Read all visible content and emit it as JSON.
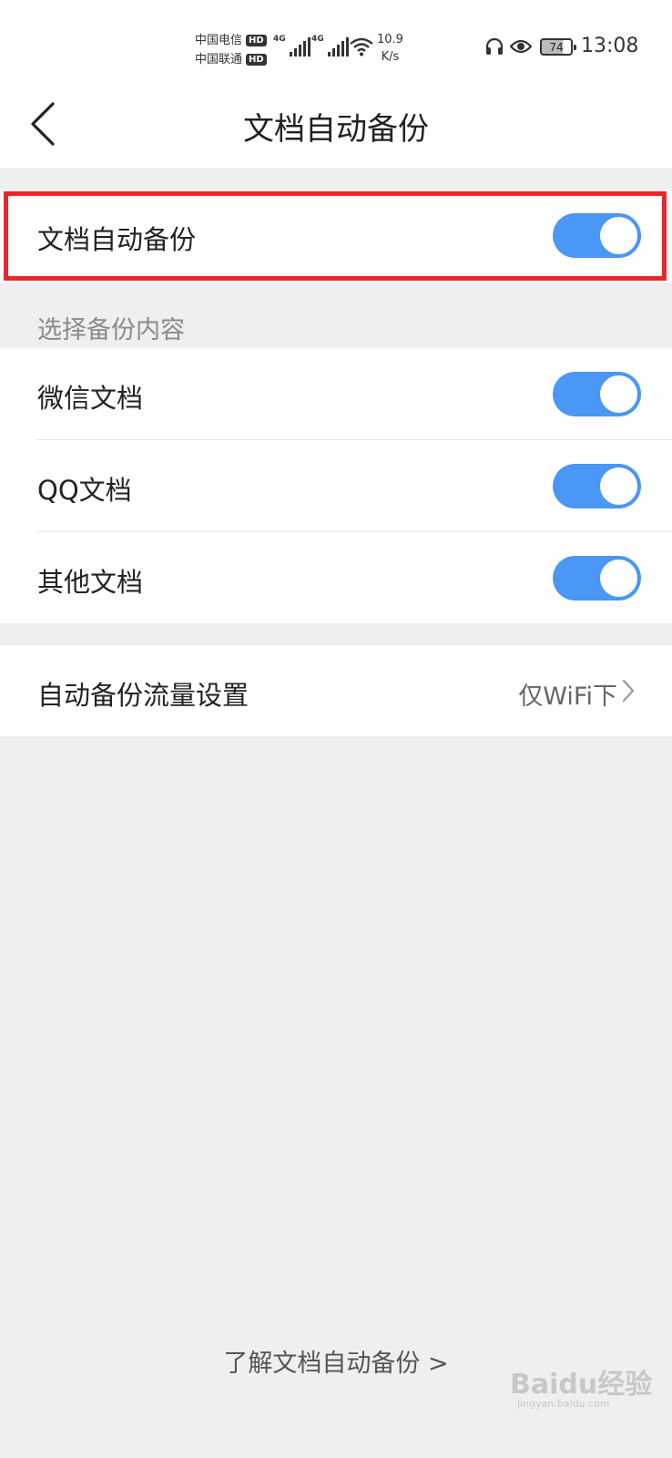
{
  "status_bar": {
    "carrier1": "中国电信",
    "carrier2": "中国联通",
    "hd": "HD",
    "net1": "4G",
    "net2": "4G",
    "speed_value": "10.9",
    "speed_unit": "K/s",
    "battery": "74",
    "time": "13:08"
  },
  "header": {
    "title": "文档自动备份"
  },
  "auto_backup": {
    "label": "文档自动备份",
    "enabled": true
  },
  "section": {
    "label": "选择备份内容"
  },
  "content_items": [
    {
      "label": "微信文档",
      "enabled": true
    },
    {
      "label": "QQ文档",
      "enabled": true
    },
    {
      "label": "其他文档",
      "enabled": true
    }
  ],
  "traffic_setting": {
    "label": "自动备份流量设置",
    "value": "仅WiFi下"
  },
  "footer": {
    "link": "了解文档自动备份 >"
  },
  "watermark": {
    "text": "Baidu经验",
    "sub": "jingyan.baidu.com"
  },
  "colors": {
    "toggle_on": "#4a97f5",
    "highlight": "#e8272b"
  }
}
